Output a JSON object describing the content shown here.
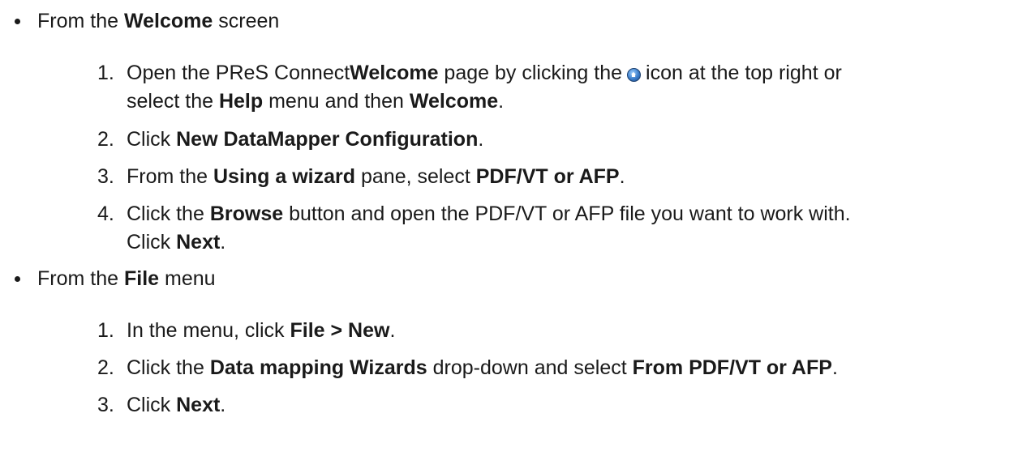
{
  "sections": [
    {
      "intro": {
        "pre": "From the ",
        "bold": "Welcome",
        "post": " screen"
      },
      "steps": [
        {
          "number": "1.",
          "parts": {
            "a": "Open the PReS Connect",
            "b": "Welcome",
            "c": " page by clicking the",
            "d": "icon at the top right or",
            "e": "select the ",
            "f": "Help",
            "g": " menu and then ",
            "h": "Welcome",
            "i": "."
          },
          "icon": "welcome-home-icon"
        },
        {
          "number": "2.",
          "parts": {
            "a": "Click ",
            "b": "New DataMapper Configuration",
            "c": "."
          }
        },
        {
          "number": "3.",
          "parts": {
            "a": "From the ",
            "b": "Using a wizard",
            "c": " pane, select ",
            "d": "PDF/VT or AFP",
            "e": "."
          }
        },
        {
          "number": "4.",
          "parts": {
            "a": "Click the ",
            "b": "Browse",
            "c": " button and open the PDF/VT or AFP file you want to work with.",
            "d": "Click ",
            "e": "Next",
            "f": "."
          }
        }
      ]
    },
    {
      "intro": {
        "pre": "From the ",
        "bold": "File",
        "post": " menu"
      },
      "steps": [
        {
          "number": "1.",
          "parts": {
            "a": "In the menu, click ",
            "b": "File > New",
            "c": "."
          }
        },
        {
          "number": "2.",
          "parts": {
            "a": "Click the ",
            "b": "Data mapping Wizards",
            "c": " drop-down and select ",
            "d": "From PDF/VT or AFP",
            "e": "."
          }
        },
        {
          "number": "3.",
          "parts": {
            "a": "Click ",
            "b": "Next",
            "c": "."
          }
        }
      ]
    }
  ]
}
